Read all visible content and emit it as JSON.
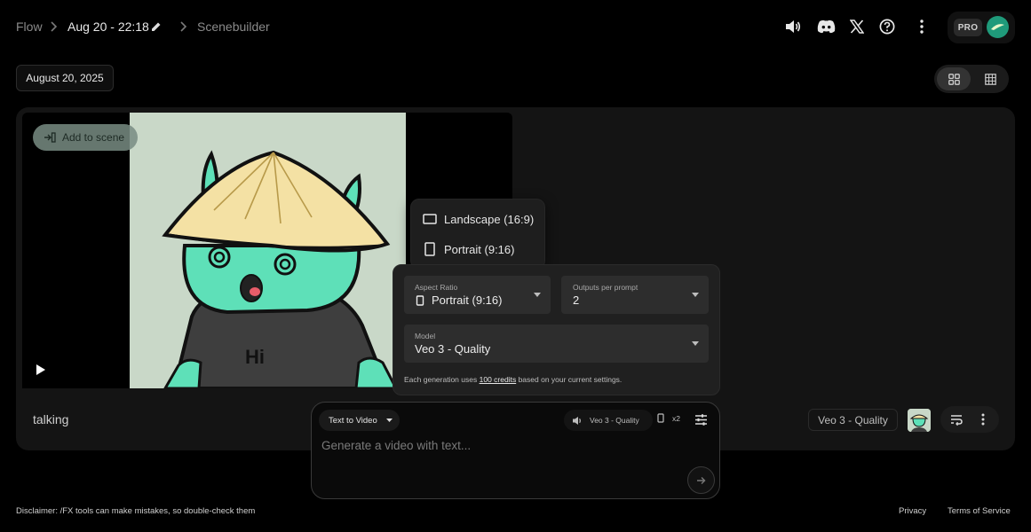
{
  "header": {
    "breadcrumbs": [
      {
        "label": "Flow"
      },
      {
        "label": "Aug 20 - 22:18"
      },
      {
        "label": "Scenebuilder"
      }
    ],
    "icons": [
      "volume-icon",
      "discord-icon",
      "x-icon",
      "help-icon",
      "more-vert-icon"
    ],
    "plan_badge": "PRO"
  },
  "date_filter": {
    "label": "August 20, 2025"
  },
  "view_toggle": {
    "options": [
      "grid-view",
      "table-view"
    ],
    "selected": "grid-view"
  },
  "clip": {
    "add_to_scene_label": "Add to scene",
    "caption": "talking",
    "model_label": "Veo 3 - Quality",
    "art_text": "Hi"
  },
  "aspect_menu": {
    "items": [
      {
        "label": "Landscape (16:9)",
        "icon": "landscape-icon"
      },
      {
        "label": "Portrait (9:16)",
        "icon": "portrait-icon"
      }
    ]
  },
  "settings": {
    "aspect_ratio": {
      "label": "Aspect Ratio",
      "value": "Portrait (9:16)"
    },
    "outputs": {
      "label": "Outputs per prompt",
      "value": "2"
    },
    "model": {
      "label": "Model",
      "value": "Veo 3 - Quality"
    },
    "note_prefix": "Each generation uses",
    "note_credits": "100 credits",
    "note_suffix": "based on your current settings."
  },
  "prompt": {
    "mode_label": "Text to Video",
    "model_chip": "Veo 3 - Quality",
    "outputs_chip": "x2",
    "placeholder": "Generate a video with text..."
  },
  "footer": {
    "disclaimer": "Disclaimer: /FX tools can make mistakes, so double-check them",
    "links": [
      "Privacy",
      "Terms of Service"
    ]
  },
  "colors": {
    "background": "#000000",
    "card": "#141414",
    "panel": "#202020",
    "accent": "#1f9a7a"
  }
}
